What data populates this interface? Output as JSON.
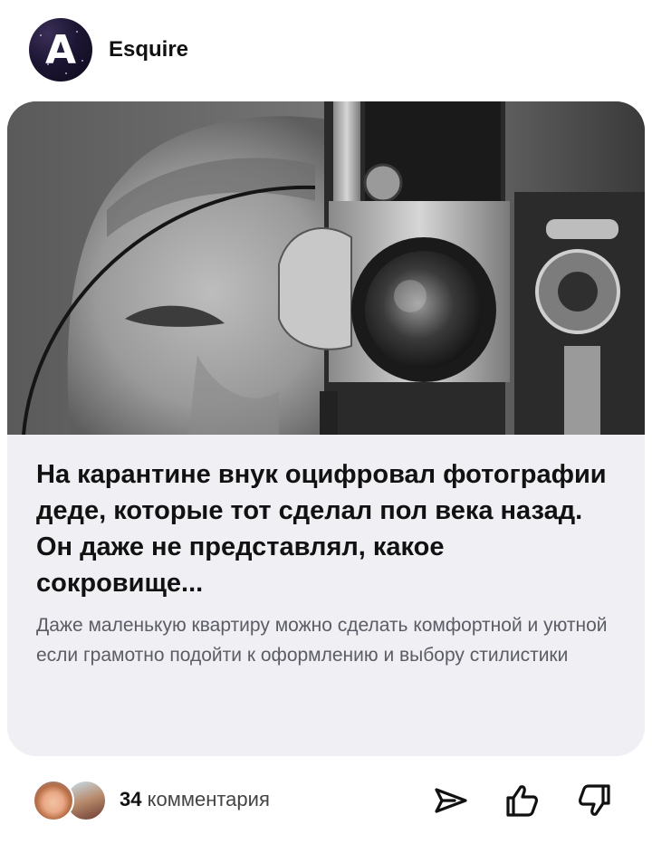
{
  "source": {
    "name": "Esquire",
    "logo_letter": "A"
  },
  "card": {
    "image_alt": "",
    "title": "На карантине внук оцифровал фотографии деде, которые тот сделал пол века назад. Он даже не представлял, какое сокровище...",
    "subtitle": "Даже маленькую квартиру можно сделать комфортной и уютной если грамотно подойти к оформлению и выбору стилистики"
  },
  "footer": {
    "comment_count": "34",
    "comment_label": "комментария"
  },
  "icons": {
    "share": "paper-plane-icon",
    "like": "thumbs-up-icon",
    "dislike": "thumbs-down-icon"
  },
  "colors": {
    "card_bg": "#efeff4",
    "title": "#111111",
    "subtitle": "#5c5c66"
  }
}
